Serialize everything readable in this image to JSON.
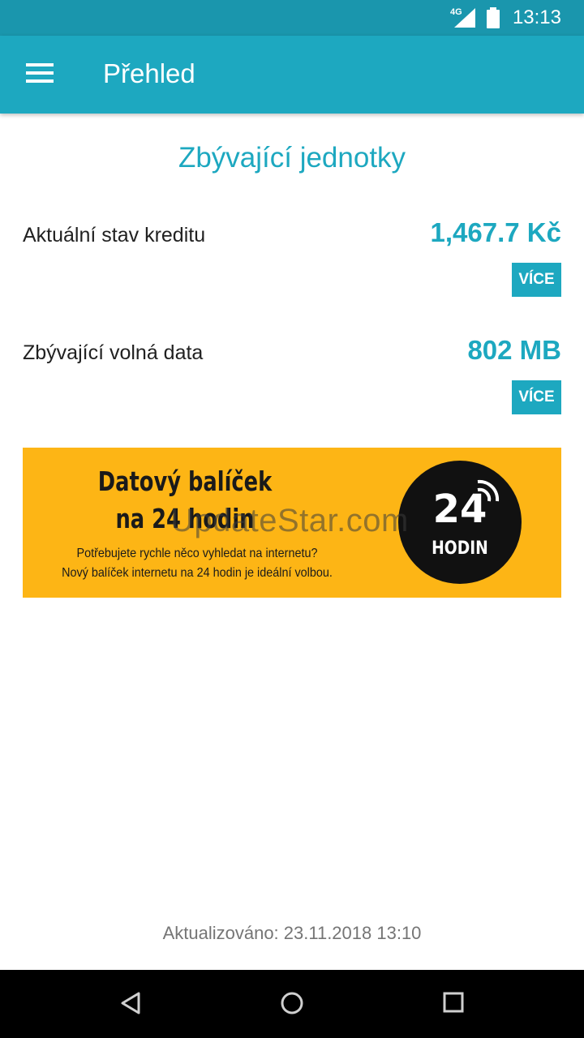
{
  "status_bar": {
    "network": "4G",
    "time": "13:13"
  },
  "app_bar": {
    "title": "Přehled"
  },
  "section": {
    "title": "Zbývající jednotky"
  },
  "credit": {
    "label": "Aktuální stav kreditu",
    "value": "1,467.7 Kč",
    "more_label": "VÍCE"
  },
  "data": {
    "label": "Zbývající volná data",
    "value": "802 MB",
    "more_label": "VÍCE"
  },
  "banner": {
    "headline_line1": "Datový balíček",
    "headline_line2": "na 24 hodin",
    "sub_line1": "Potřebujete rychle něco vyhledat na internetu?",
    "sub_line2": "Nový balíček internetu na 24 hodin je ideální volbou.",
    "badge_number": "24",
    "badge_unit": "HODIN",
    "background_color": "#fdb515"
  },
  "watermark": "UpdateStar.com",
  "footer": {
    "updated": "Aktualizováno: 23.11.2018 13:10"
  },
  "colors": {
    "accent": "#1da8c0",
    "status_bar": "#1a96ad"
  }
}
